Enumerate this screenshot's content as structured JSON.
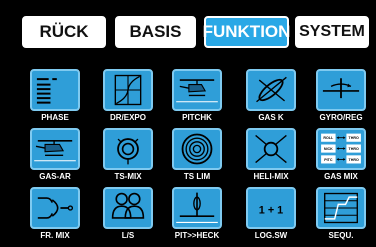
{
  "tabs": [
    {
      "label": "RÜCK",
      "active": false
    },
    {
      "label": "BASIS",
      "active": false
    },
    {
      "label": "FUNKTION",
      "active": true
    },
    {
      "label": "SYSTEM",
      "active": false
    }
  ],
  "accent_color": "#29a8e6",
  "menu_items": [
    {
      "label": "PHASE",
      "icon": "phase-list-icon"
    },
    {
      "label": "DR/EXPO",
      "icon": "expo-grid-icon"
    },
    {
      "label": "PITCHK",
      "icon": "helicopter-pitch-icon"
    },
    {
      "label": "GAS K",
      "icon": "throttle-curve-icon"
    },
    {
      "label": "GYRO/REG",
      "icon": "gyro-icon"
    },
    {
      "label": "GAS-AR",
      "icon": "helicopter-autorotation-icon"
    },
    {
      "label": "TS-MIX",
      "icon": "swashplate-mix-icon"
    },
    {
      "label": "TS LIM",
      "icon": "swashplate-limit-icon"
    },
    {
      "label": "HELI-MIX",
      "icon": "heli-mixer-icon"
    },
    {
      "label": "GAS MIX",
      "icon": "throttle-mix-icon",
      "mix_rows": [
        [
          "ROLL",
          "THRO"
        ],
        [
          "NICK",
          "THRO"
        ],
        [
          "PITC",
          "THRO"
        ]
      ]
    },
    {
      "label": "FR. MIX",
      "icon": "free-mixer-icon"
    },
    {
      "label": "L/S",
      "icon": "teacher-student-icon"
    },
    {
      "label": "PIT>>HECK",
      "icon": "pitch-to-tail-icon"
    },
    {
      "label": "LOG.SW",
      "icon": "logic-switch-icon",
      "icon_text": "1 + 1"
    },
    {
      "label": "SEQU.",
      "icon": "sequencer-icon"
    }
  ]
}
